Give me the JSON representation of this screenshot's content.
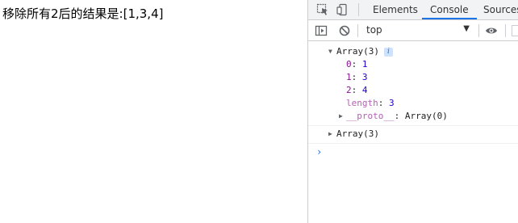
{
  "page": {
    "text": "移除所有2后的结果是:[1,3,4]"
  },
  "devtools": {
    "tabs": [
      {
        "label": "Elements"
      },
      {
        "label": "Console"
      },
      {
        "label": "Sources"
      }
    ],
    "active_tab": "Console",
    "context": "top",
    "accent_color": "#1a73e8"
  },
  "console": {
    "entry1": {
      "summary": "Array(3)",
      "items": [
        {
          "key": "0",
          "value": "1"
        },
        {
          "key": "1",
          "value": "3"
        },
        {
          "key": "2",
          "value": "4"
        }
      ],
      "length_key": "length",
      "length_value": "3",
      "proto_key": "__proto__",
      "proto_value": "Array(0)"
    },
    "entry2": {
      "summary": "Array(3)"
    },
    "prompt": "›"
  }
}
